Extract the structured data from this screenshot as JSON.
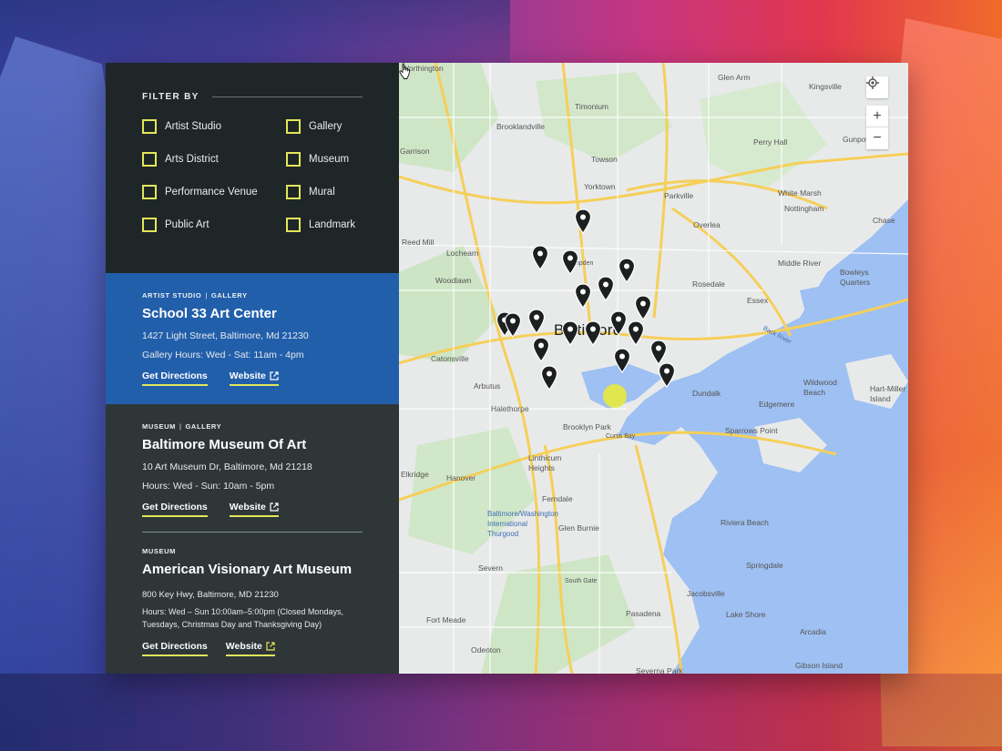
{
  "filter": {
    "title": "FILTER BY",
    "options": [
      {
        "label": "Artist Studio"
      },
      {
        "label": "Gallery"
      },
      {
        "label": "Arts District"
      },
      {
        "label": "Museum"
      },
      {
        "label": "Performance Venue"
      },
      {
        "label": "Mural"
      },
      {
        "label": "Public Art"
      },
      {
        "label": "Landmark"
      }
    ]
  },
  "listings": [
    {
      "categories": [
        "ARTIST STUDIO",
        "GALLERY"
      ],
      "separator": "|",
      "name": "School 33 Art Center",
      "address": "1427 Light Street, Baltimore, Md 21230",
      "hours": "Gallery Hours: Wed - Sat: 11am - 4pm",
      "directions_label": "Get Directions",
      "website_label": "Website"
    },
    {
      "categories": [
        "MUSEUM",
        "GALLERY"
      ],
      "separator": "|",
      "name": "Baltimore Museum Of Art",
      "address": "10 Art Museum Dr, Baltimore, Md 21218",
      "hours": "Hours: Wed - Sun: 10am - 5pm",
      "directions_label": "Get Directions",
      "website_label": "Website"
    },
    {
      "categories": [
        "MUSEUM"
      ],
      "name": "American Visionary Art Museum",
      "address": "800 Key Hwy, Baltimore, MD 21230",
      "hours": "Hours: Wed – Sun 10:00am–5:00pm (Closed Mondays, Tuesdays, Christmas Day and Thanksgiving Day)",
      "directions_label": "Get Directions",
      "website_label": "Website"
    }
  ],
  "map": {
    "city": "Baltimore",
    "labels": [
      "Worthington",
      "Glen Arm",
      "Kingsville",
      "Timonium",
      "Brooklandville",
      "Perry Hall",
      "Gunpowder",
      "Garrison",
      "Towson",
      "Yorktown",
      "Parkville",
      "White Marsh",
      "Nottingham",
      "Chase",
      "Overlea",
      "Reed Mill",
      "Lochearn",
      "Hampden",
      "Middle River",
      "Bowleys Quarters",
      "Woodlawn",
      "Rosedale",
      "Essex",
      "Catonsville",
      "Arbutus",
      "Halethorpe",
      "Brooklyn Park",
      "Curtis Bay",
      "Dundalk",
      "Sparrows Point",
      "Edgemere",
      "Wildwood Beach",
      "Hart-Miller Island",
      "Elkridge",
      "Hanover",
      "Linthicum Heights",
      "Ferndale",
      "Glen Burnie",
      "Riviera Beach",
      "Baltimore/Washington International Thurgood",
      "Severn",
      "Jacobsville",
      "Springdale",
      "Lake Shore",
      "Fort Meade",
      "Pasadena",
      "Arcadia",
      "Odenton",
      "Severna Park",
      "Gibson Island",
      "South Gate",
      "Back River"
    ],
    "controls": {
      "zoom_in": "+",
      "zoom_out": "−"
    },
    "pin_count": 19
  },
  "colors": {
    "accent_yellow": "#e3e65a",
    "active_blue": "#225fab",
    "sidebar_dark": "#2e3638",
    "filter_dark": "#1f2628"
  }
}
